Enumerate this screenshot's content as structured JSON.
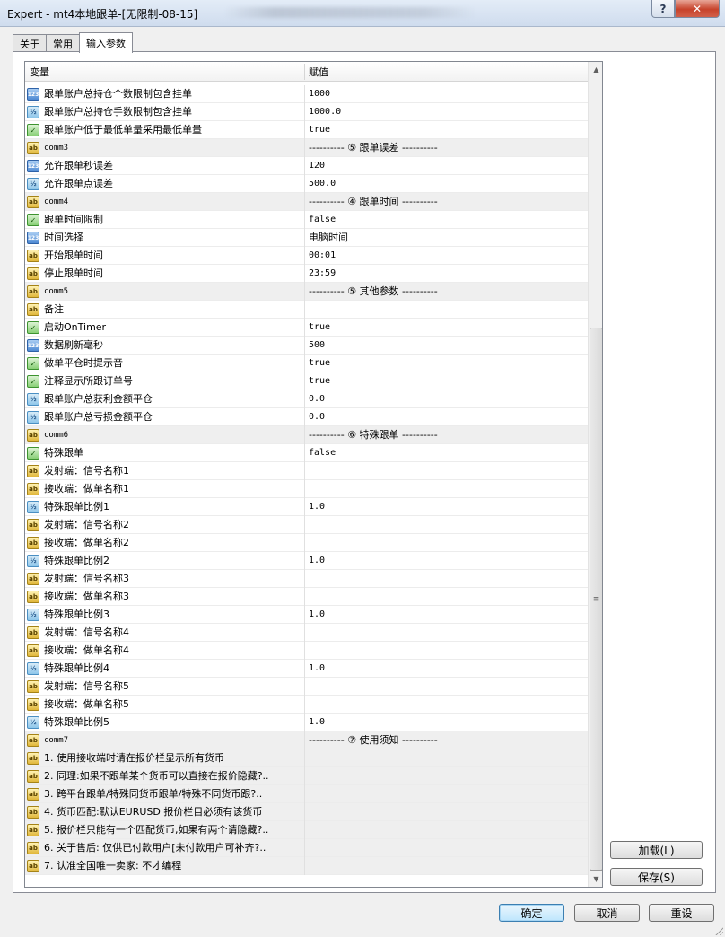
{
  "window": {
    "title": "Expert - mt4本地跟单-[无限制-08-15]",
    "help_icon": "?",
    "close_icon": "✕"
  },
  "tabs": [
    {
      "label": "关于",
      "active": false
    },
    {
      "label": "常用",
      "active": false
    },
    {
      "label": "输入参数",
      "active": true
    }
  ],
  "grid": {
    "col_variable": "变量",
    "col_value": "赋值",
    "rows": [
      {
        "type": "int",
        "icon": "123",
        "name": "跟单账户总持仓个数限制包含挂单",
        "value": "1000"
      },
      {
        "type": "dbl",
        "icon": "½",
        "name": "跟单账户总持仓手数限制包含挂单",
        "value": "1000.0"
      },
      {
        "type": "bool",
        "icon": "✓",
        "name": "跟单账户低于最低单量采用最低单量",
        "value": "true"
      },
      {
        "type": "str",
        "icon": "ab",
        "name": "comm3",
        "value": "---------- ⑤ 跟单误差 ----------",
        "shaded": true
      },
      {
        "type": "int",
        "icon": "123",
        "name": "允许跟单秒误差",
        "value": "120"
      },
      {
        "type": "dbl",
        "icon": "½",
        "name": "允许跟单点误差",
        "value": "500.0"
      },
      {
        "type": "str",
        "icon": "ab",
        "name": "comm4",
        "value": "---------- ④ 跟单时间 ----------",
        "shaded": true
      },
      {
        "type": "bool",
        "icon": "✓",
        "name": "跟单时间限制",
        "value": "false"
      },
      {
        "type": "int",
        "icon": "123",
        "name": "时间选择",
        "value": "电脑时间"
      },
      {
        "type": "str",
        "icon": "ab",
        "name": "开始跟单时间",
        "value": "00:01"
      },
      {
        "type": "str",
        "icon": "ab",
        "name": "停止跟单时间",
        "value": "23:59"
      },
      {
        "type": "str",
        "icon": "ab",
        "name": "comm5",
        "value": "---------- ⑤ 其他参数 ----------",
        "shaded": true
      },
      {
        "type": "str",
        "icon": "ab",
        "name": "备注",
        "value": ""
      },
      {
        "type": "bool",
        "icon": "✓",
        "name": "启动OnTimer",
        "value": "true"
      },
      {
        "type": "int",
        "icon": "123",
        "name": "数据刷新毫秒",
        "value": "500"
      },
      {
        "type": "bool",
        "icon": "✓",
        "name": "做单平仓时提示音",
        "value": "true"
      },
      {
        "type": "bool",
        "icon": "✓",
        "name": "注释显示所跟订单号",
        "value": "true"
      },
      {
        "type": "dbl",
        "icon": "½",
        "name": "跟单账户总获利金额平仓",
        "value": "0.0"
      },
      {
        "type": "dbl",
        "icon": "½",
        "name": "跟单账户总亏损金额平仓",
        "value": "0.0"
      },
      {
        "type": "str",
        "icon": "ab",
        "name": "comm6",
        "value": "---------- ⑥ 特殊跟单 ----------",
        "shaded": true
      },
      {
        "type": "bool",
        "icon": "✓",
        "name": "特殊跟单",
        "value": "false"
      },
      {
        "type": "str",
        "icon": "ab",
        "name": "发射端：信号名称1",
        "value": ""
      },
      {
        "type": "str",
        "icon": "ab",
        "name": "接收端：做单名称1",
        "value": ""
      },
      {
        "type": "dbl",
        "icon": "½",
        "name": "特殊跟单比例1",
        "value": "1.0"
      },
      {
        "type": "str",
        "icon": "ab",
        "name": "发射端：信号名称2",
        "value": ""
      },
      {
        "type": "str",
        "icon": "ab",
        "name": "接收端：做单名称2",
        "value": ""
      },
      {
        "type": "dbl",
        "icon": "½",
        "name": "特殊跟单比例2",
        "value": "1.0"
      },
      {
        "type": "str",
        "icon": "ab",
        "name": "发射端：信号名称3",
        "value": ""
      },
      {
        "type": "str",
        "icon": "ab",
        "name": "接收端：做单名称3",
        "value": ""
      },
      {
        "type": "dbl",
        "icon": "½",
        "name": "特殊跟单比例3",
        "value": "1.0"
      },
      {
        "type": "str",
        "icon": "ab",
        "name": "发射端：信号名称4",
        "value": ""
      },
      {
        "type": "str",
        "icon": "ab",
        "name": "接收端：做单名称4",
        "value": ""
      },
      {
        "type": "dbl",
        "icon": "½",
        "name": "特殊跟单比例4",
        "value": "1.0"
      },
      {
        "type": "str",
        "icon": "ab",
        "name": "发射端：信号名称5",
        "value": ""
      },
      {
        "type": "str",
        "icon": "ab",
        "name": "接收端：做单名称5",
        "value": ""
      },
      {
        "type": "dbl",
        "icon": "½",
        "name": "特殊跟单比例5",
        "value": "1.0"
      },
      {
        "type": "str",
        "icon": "ab",
        "name": "comm7",
        "value": "---------- ⑦ 使用须知 ----------",
        "shaded": true
      },
      {
        "type": "str",
        "icon": "ab",
        "name": "1. 使用接收端时请在报价栏显示所有货币",
        "value": "",
        "shaded": true
      },
      {
        "type": "str",
        "icon": "ab",
        "name": "2. 同理:如果不跟单某个货币可以直接在报价隐藏?..",
        "value": "",
        "shaded": true
      },
      {
        "type": "str",
        "icon": "ab",
        "name": "3. 跨平台跟单/特殊同货币跟单/特殊不同货币跟?..",
        "value": "",
        "shaded": true
      },
      {
        "type": "str",
        "icon": "ab",
        "name": "4. 货币匹配:默认EURUSD 报价栏目必须有该货币",
        "value": "",
        "shaded": true
      },
      {
        "type": "str",
        "icon": "ab",
        "name": "5. 报价栏只能有一个匹配货币,如果有两个请隐藏?..",
        "value": "",
        "shaded": true
      },
      {
        "type": "str",
        "icon": "ab",
        "name": "6. 关于售后: 仅供已付款用户[未付款用户可补齐?..",
        "value": "",
        "shaded": true
      },
      {
        "type": "str",
        "icon": "ab",
        "name": "7. 认准全国唯一卖家: 不才编程",
        "value": "",
        "shaded": true
      }
    ]
  },
  "scrollbar": {
    "up_icon": "▲",
    "down_icon": "▼",
    "grip_icon": "≡"
  },
  "buttons": {
    "load": "加载(L)",
    "save": "保存(S)",
    "ok": "确定",
    "cancel": "取消",
    "reset": "重设"
  }
}
